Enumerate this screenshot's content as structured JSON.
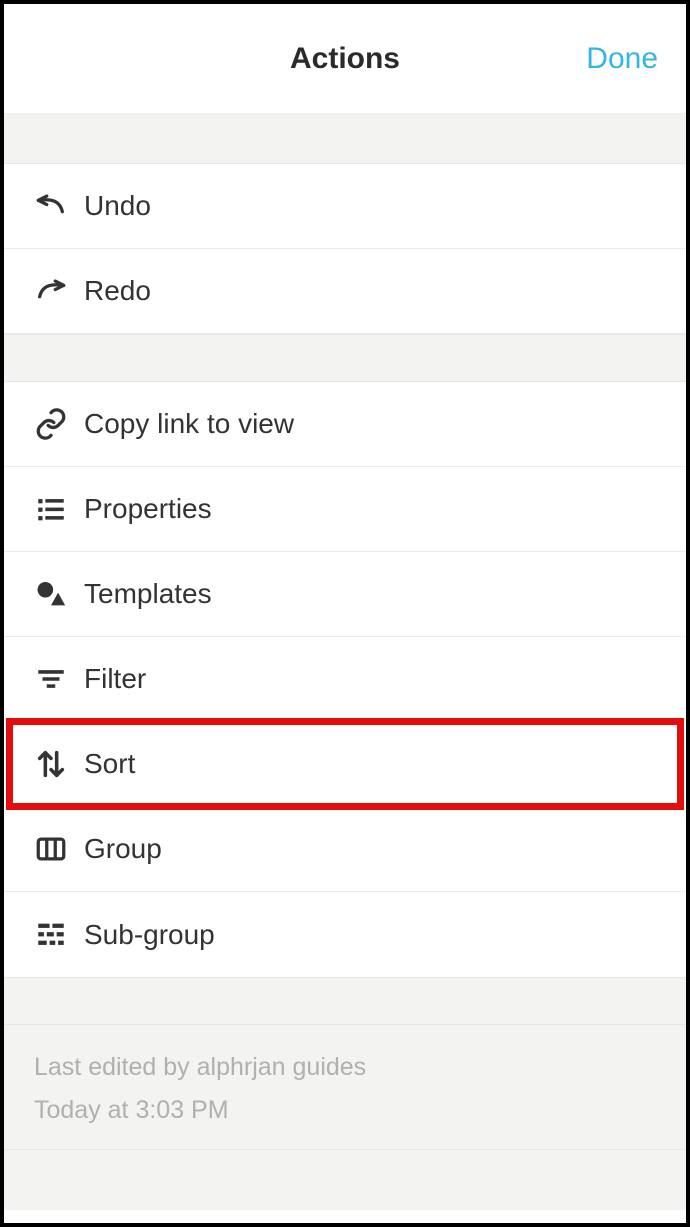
{
  "header": {
    "title": "Actions",
    "done": "Done"
  },
  "group1": {
    "undo": "Undo",
    "redo": "Redo"
  },
  "group2": {
    "copyLink": "Copy link to view",
    "properties": "Properties",
    "templates": "Templates",
    "filter": "Filter",
    "sort": "Sort",
    "group": "Group",
    "subgroup": "Sub-group"
  },
  "footer": {
    "editedBy": "Last edited by alphrjan guides",
    "timestamp": "Today at 3:03 PM"
  }
}
